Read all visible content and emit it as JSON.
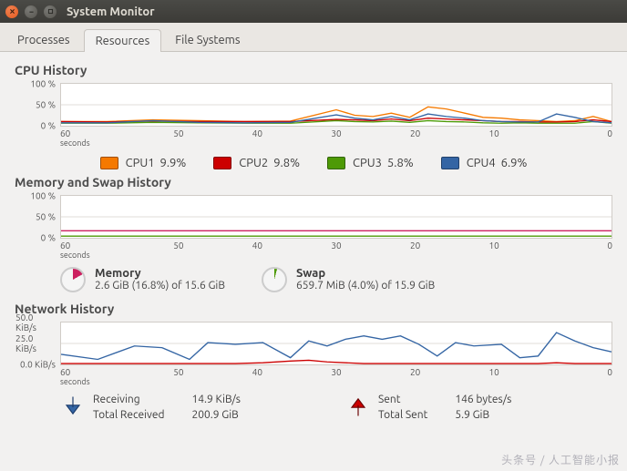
{
  "window": {
    "title": "System Monitor"
  },
  "tabs": {
    "processes": "Processes",
    "resources": "Resources",
    "filesystems": "File Systems",
    "active": "resources"
  },
  "cpu": {
    "title": "CPU History",
    "yticks": [
      "100 %",
      "50 %",
      "0 %"
    ],
    "xticks": [
      "60",
      "50",
      "40",
      "30",
      "20",
      "10",
      "0"
    ],
    "xunit": "seconds",
    "legend": [
      {
        "name": "CPU1",
        "value": "9.9%",
        "color": "#f57900"
      },
      {
        "name": "CPU2",
        "value": "9.8%",
        "color": "#cc0000"
      },
      {
        "name": "CPU3",
        "value": "5.8%",
        "color": "#4e9a06"
      },
      {
        "name": "CPU4",
        "value": "6.9%",
        "color": "#3465a4"
      }
    ]
  },
  "mem": {
    "title": "Memory and Swap History",
    "yticks": [
      "100 %",
      "50 %",
      "0 %"
    ],
    "xticks": [
      "60",
      "50",
      "40",
      "30",
      "20",
      "10",
      "0"
    ],
    "xunit": "seconds",
    "memory": {
      "label": "Memory",
      "text": "2.6 GiB (16.8%) of 15.6 GiB",
      "pct": 16.8,
      "color": "#cc2060"
    },
    "swap": {
      "label": "Swap",
      "text": "659.7 MiB (4.0%) of 15.9 GiB",
      "pct": 4.0,
      "color": "#4e9a06"
    }
  },
  "net": {
    "title": "Network History",
    "yticks": [
      "50.0 KiB/s",
      "25.0 KiB/s",
      "0.0 KiB/s"
    ],
    "xticks": [
      "60",
      "50",
      "40",
      "30",
      "20",
      "10",
      "0"
    ],
    "xunit": "seconds",
    "recv": {
      "label": "Receiving",
      "rate": "14.9 KiB/s",
      "total_label": "Total Received",
      "total": "200.9 GiB",
      "color": "#3465a4"
    },
    "sent": {
      "label": "Sent",
      "rate": "146 bytes/s",
      "total_label": "Total Sent",
      "total": "5.9 GiB",
      "color": "#cc0000"
    }
  },
  "watermark": "头条号 / 人工智能小报",
  "chart_data": [
    {
      "type": "line",
      "title": "CPU History",
      "xlabel": "seconds",
      "ylabel": "%",
      "xlim": [
        0,
        60
      ],
      "ylim": [
        0,
        100
      ],
      "x": [
        60,
        55,
        50,
        45,
        40,
        35,
        30,
        28,
        26,
        24,
        22,
        20,
        18,
        16,
        14,
        12,
        10,
        8,
        6,
        4,
        2,
        0
      ],
      "series": [
        {
          "name": "CPU1",
          "color": "#f57900",
          "values": [
            10,
            10,
            14,
            12,
            10,
            11,
            38,
            25,
            22,
            30,
            20,
            45,
            40,
            30,
            20,
            18,
            14,
            12,
            10,
            12,
            22,
            10
          ]
        },
        {
          "name": "CPU2",
          "color": "#cc0000",
          "values": [
            10,
            9,
            11,
            10,
            10,
            10,
            15,
            14,
            12,
            16,
            12,
            18,
            16,
            14,
            12,
            10,
            10,
            9,
            9,
            10,
            14,
            10
          ]
        },
        {
          "name": "CPU3",
          "color": "#4e9a06",
          "values": [
            6,
            6,
            8,
            7,
            6,
            6,
            12,
            10,
            9,
            11,
            8,
            12,
            10,
            9,
            7,
            6,
            7,
            6,
            6,
            6,
            10,
            6
          ]
        },
        {
          "name": "CPU4",
          "color": "#3465a4",
          "values": [
            7,
            7,
            12,
            8,
            7,
            8,
            26,
            18,
            14,
            22,
            14,
            28,
            22,
            18,
            12,
            10,
            9,
            9,
            28,
            20,
            10,
            7
          ]
        }
      ]
    },
    {
      "type": "line",
      "title": "Memory and Swap History",
      "xlabel": "seconds",
      "ylabel": "%",
      "xlim": [
        0,
        60
      ],
      "ylim": [
        0,
        100
      ],
      "x": [
        60,
        0
      ],
      "series": [
        {
          "name": "Memory",
          "color": "#cc2060",
          "values": [
            16.8,
            16.8
          ]
        },
        {
          "name": "Swap",
          "color": "#4e9a06",
          "values": [
            4.0,
            4.0
          ]
        }
      ]
    },
    {
      "type": "line",
      "title": "Network History",
      "xlabel": "seconds",
      "ylabel": "KiB/s",
      "xlim": [
        0,
        60
      ],
      "ylim": [
        0,
        50
      ],
      "x": [
        60,
        56,
        52,
        49,
        46,
        44,
        41,
        38,
        35,
        33,
        31,
        29,
        27,
        25,
        23,
        21,
        19,
        17,
        15,
        12,
        10,
        8,
        6,
        4,
        2,
        0
      ],
      "series": [
        {
          "name": "Receiving",
          "color": "#3465a4",
          "values": [
            12,
            6,
            22,
            20,
            6,
            26,
            24,
            26,
            8,
            28,
            22,
            30,
            34,
            30,
            34,
            24,
            10,
            26,
            22,
            24,
            8,
            10,
            38,
            28,
            20,
            15
          ]
        },
        {
          "name": "Sent",
          "color": "#cc0000",
          "values": [
            1,
            1,
            1,
            1,
            1,
            1,
            1,
            2,
            4,
            5,
            3,
            2,
            1,
            1,
            1,
            1,
            1,
            1,
            1,
            1,
            1,
            1,
            2,
            1,
            1,
            1
          ]
        }
      ]
    }
  ]
}
